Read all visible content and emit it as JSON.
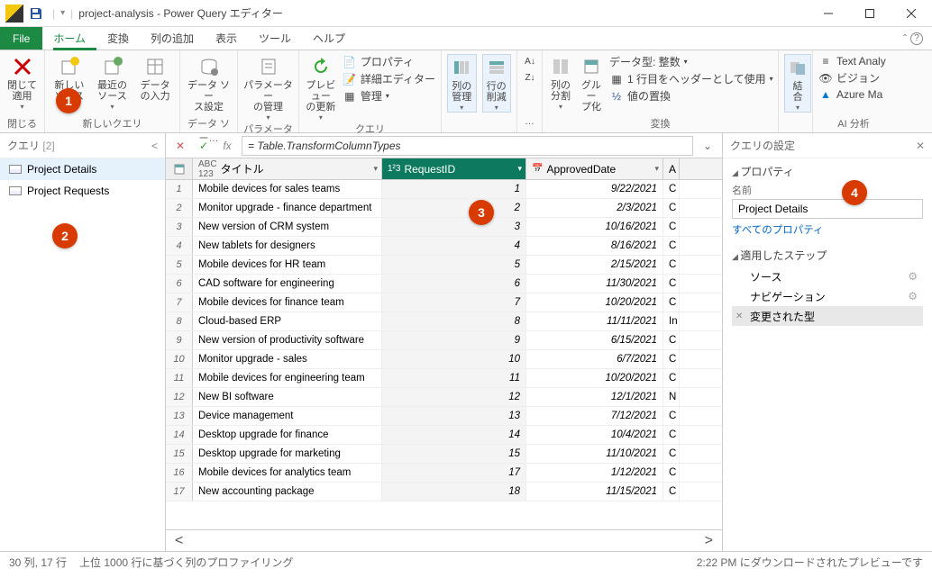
{
  "title": "project-analysis - Power Query エディター",
  "tabs": {
    "file": "File",
    "home": "ホーム",
    "transform": "変換",
    "addcol": "列の追加",
    "view": "表示",
    "tools": "ツール",
    "help": "ヘルプ"
  },
  "ribbon": {
    "close": {
      "btn": "閉じて\n適用",
      "group": "閉じる"
    },
    "newquery": {
      "newsrc": "新しい\nソース",
      "recent": "最近の\nソース",
      "enter": "データ\nの入力",
      "group": "新しいクエリ"
    },
    "datasrc": {
      "btn": "データ ソー\nス設定",
      "group": "データ ソー…"
    },
    "param": {
      "btn": "パラメーター\nの管理",
      "group": "パラメーター"
    },
    "query": {
      "refresh": "プレビュー\nの更新",
      "props": "プロパティ",
      "adv": "詳細エディター",
      "manage": "管理",
      "group": "クエリ"
    },
    "cols": {
      "manage": "列の\n管理",
      "reduce": "行の\n削減"
    },
    "sort": {
      "group": "…"
    },
    "transform": {
      "split": "列の\n分割",
      "groupby": "グルー\nプ化",
      "dtype": "データ型: 整数",
      "firstrow": "1 行目をヘッダーとして使用",
      "replace": "値の置換",
      "group": "変換"
    },
    "combine": {
      "btn": "結\n合",
      "group": ""
    },
    "ai": {
      "textanaly": "Text Analy",
      "vision": "ビジョン",
      "azureml": "Azure Ma",
      "group": "AI 分析"
    }
  },
  "queriesPane": {
    "title": "クエリ",
    "count": "[2]",
    "items": [
      "Project Details",
      "Project Requests"
    ]
  },
  "formula": "= Table.TransformColumnTypes",
  "columns": {
    "c1": "タイトル",
    "c2": "RequestID",
    "c3": "ApprovedDate",
    "c4": "A"
  },
  "rows": [
    {
      "n": "1",
      "title": "Mobile devices for sales teams",
      "id": "1",
      "date": "9/22/2021",
      "c4": "C"
    },
    {
      "n": "2",
      "title": "Monitor upgrade - finance department",
      "id": "2",
      "date": "2/3/2021",
      "c4": "C"
    },
    {
      "n": "3",
      "title": "New version of CRM system",
      "id": "3",
      "date": "10/16/2021",
      "c4": "C"
    },
    {
      "n": "4",
      "title": "New tablets for designers",
      "id": "4",
      "date": "8/16/2021",
      "c4": "C"
    },
    {
      "n": "5",
      "title": "Mobile devices for HR team",
      "id": "5",
      "date": "2/15/2021",
      "c4": "C"
    },
    {
      "n": "6",
      "title": "CAD software for engineering",
      "id": "6",
      "date": "11/30/2021",
      "c4": "C"
    },
    {
      "n": "7",
      "title": "Mobile devices for finance team",
      "id": "7",
      "date": "10/20/2021",
      "c4": "C"
    },
    {
      "n": "8",
      "title": "Cloud-based ERP",
      "id": "8",
      "date": "11/11/2021",
      "c4": "In"
    },
    {
      "n": "9",
      "title": "New version of productivity software",
      "id": "9",
      "date": "6/15/2021",
      "c4": "C"
    },
    {
      "n": "10",
      "title": "Monitor upgrade - sales",
      "id": "10",
      "date": "6/7/2021",
      "c4": "C"
    },
    {
      "n": "11",
      "title": "Mobile devices for engineering team",
      "id": "11",
      "date": "10/20/2021",
      "c4": "C"
    },
    {
      "n": "12",
      "title": "New BI software",
      "id": "12",
      "date": "12/1/2021",
      "c4": "N"
    },
    {
      "n": "13",
      "title": "Device management",
      "id": "13",
      "date": "7/12/2021",
      "c4": "C"
    },
    {
      "n": "14",
      "title": "Desktop upgrade for finance",
      "id": "14",
      "date": "10/4/2021",
      "c4": "C"
    },
    {
      "n": "15",
      "title": "Desktop upgrade for marketing",
      "id": "15",
      "date": "11/10/2021",
      "c4": "C"
    },
    {
      "n": "16",
      "title": "Mobile devices for analytics team",
      "id": "17",
      "date": "1/12/2021",
      "c4": "C"
    },
    {
      "n": "17",
      "title": "New accounting package",
      "id": "18",
      "date": "11/15/2021",
      "c4": "C"
    }
  ],
  "settings": {
    "title": "クエリの設定",
    "props": "プロパティ",
    "nameLabel": "名前",
    "name": "Project Details",
    "allProps": "すべてのプロパティ",
    "stepsTitle": "適用したステップ",
    "steps": [
      "ソース",
      "ナビゲーション",
      "変更された型"
    ]
  },
  "status": {
    "left1": "30 列, 17 行",
    "left2": "上位 1000 行に基づく列のプロファイリング",
    "right": "2:22 PM にダウンロードされたプレビューです"
  },
  "callouts": {
    "1": "1",
    "2": "2",
    "3": "3",
    "4": "4"
  }
}
